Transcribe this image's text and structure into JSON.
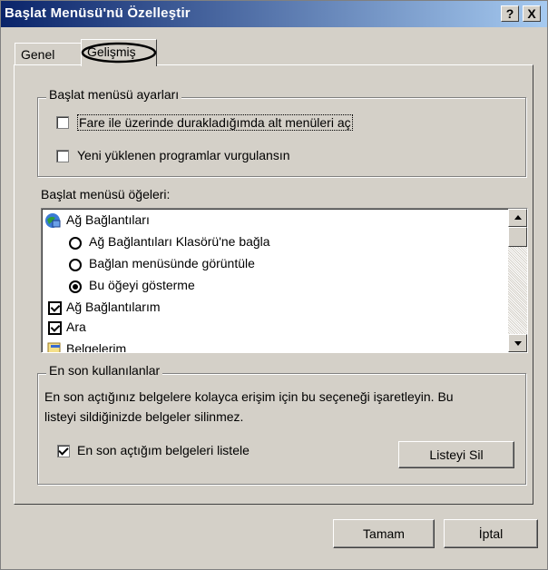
{
  "window": {
    "title": "Başlat Menüsü'nü Özelleştir",
    "help_glyph": "?",
    "close_glyph": "X"
  },
  "tabs": [
    {
      "label": "Genel"
    },
    {
      "label": "Gelişmiş"
    }
  ],
  "start_settings": {
    "legend": "Başlat menüsü ayarları",
    "options": [
      {
        "label": "Fare ile üzerinde durakladığımda alt menüleri aç",
        "checked": false
      },
      {
        "label": "Yeni yüklenen programlar vurgulansın",
        "checked": false
      }
    ]
  },
  "items": {
    "label": "Başlat menüsü öğeleri:",
    "rows": [
      {
        "type": "group",
        "label": "Ağ Bağlantıları",
        "icon": "network-globe-icon"
      },
      {
        "type": "radio",
        "label": "Ağ Bağlantıları Klasörü'ne bağla",
        "selected": false
      },
      {
        "type": "radio",
        "label": "Bağlan menüsünde görüntüle",
        "selected": false
      },
      {
        "type": "radio",
        "label": "Bu öğeyi gösterme",
        "selected": true
      },
      {
        "type": "check",
        "label": "Ağ Bağlantılarım",
        "checked": true
      },
      {
        "type": "check",
        "label": "Ara",
        "checked": true
      },
      {
        "type": "group",
        "label": "Belgelerim",
        "icon": "documents-icon"
      }
    ]
  },
  "recent": {
    "legend": "En son kullanılanlar",
    "description_line1": "En son açtığınız belgelere kolayca erişim için bu seçeneği işaretleyin.  Bu",
    "description_line2": "listeyi sildiğinizde belgeler silinmez.",
    "checkbox_label": "En son açtığım belgeleri listele",
    "checkbox_checked": true,
    "clear_button": "Listeyi Sil"
  },
  "footer": {
    "ok_button": "Tamam",
    "cancel_button": "İptal"
  },
  "colors": {
    "title_start": "#0a246a",
    "title_end": "#a6caf0",
    "face": "#d4d0c8"
  }
}
